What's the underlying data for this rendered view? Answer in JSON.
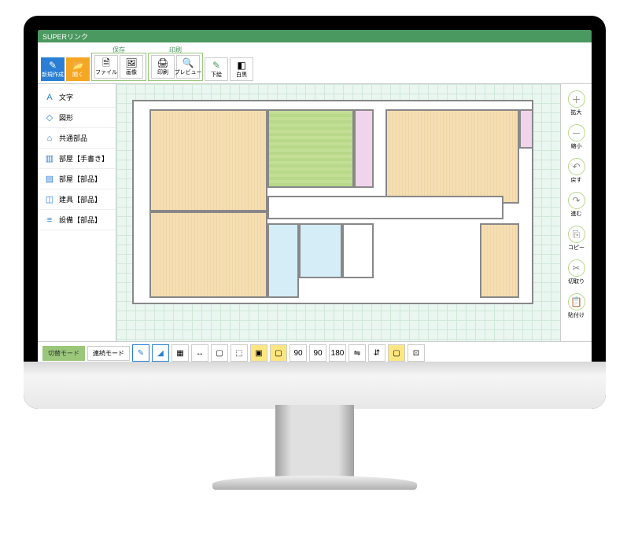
{
  "app": {
    "title": "SUPERリンク"
  },
  "toolbar": {
    "new_label": "新規作成",
    "open_label": "開く",
    "groups": {
      "save": {
        "label": "保存",
        "file": "ファイル",
        "image": "画像"
      },
      "print": {
        "label": "印刷",
        "print": "印刷",
        "preview": "プレビュー"
      }
    },
    "draft_label": "下絵",
    "bw_label": "白黒"
  },
  "left": {
    "items": [
      {
        "icon": "A",
        "label": "文字"
      },
      {
        "icon": "◇",
        "label": "図形"
      },
      {
        "icon": "⌂",
        "label": "共通部品"
      },
      {
        "icon": "▥",
        "label": "部屋【手書き】"
      },
      {
        "icon": "▤",
        "label": "部屋【部品】"
      },
      {
        "icon": "◫",
        "label": "建具【部品】"
      },
      {
        "icon": "≡",
        "label": "設備【部品】"
      }
    ]
  },
  "right": {
    "items": [
      {
        "icon": "＋",
        "label": "拡大"
      },
      {
        "icon": "－",
        "label": "縮小"
      },
      {
        "icon": "↶",
        "label": "戻す"
      },
      {
        "icon": "↷",
        "label": "進む"
      },
      {
        "icon": "⎘",
        "label": "コピー"
      },
      {
        "icon": "✂",
        "label": "切取り"
      },
      {
        "icon": "📋",
        "label": "貼付け"
      }
    ]
  },
  "bottom": {
    "mode_toggle": "切替モード",
    "mode_continuous": "連続モード",
    "rot90a": "90",
    "rot90b": "90",
    "rot180": "180"
  }
}
